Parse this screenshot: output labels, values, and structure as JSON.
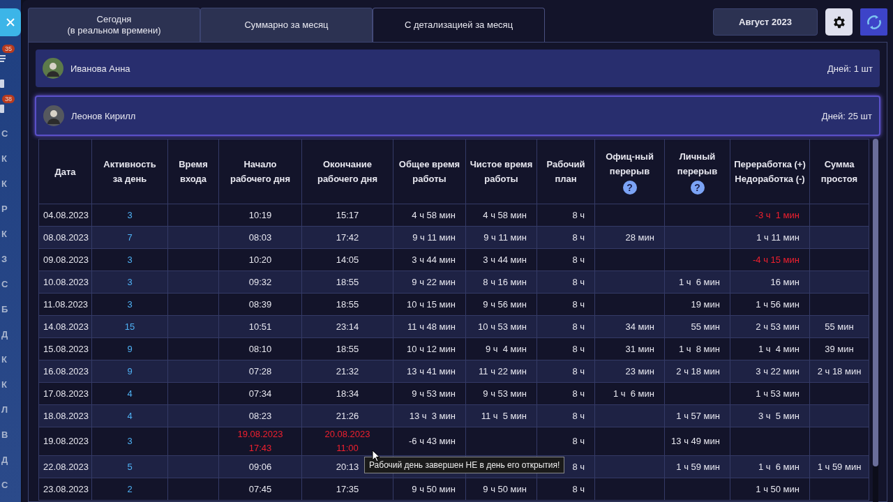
{
  "sidebar": {
    "icons": [
      {
        "kind": "list",
        "badge": "35"
      },
      {
        "kind": "square"
      },
      {
        "kind": "square",
        "badge": "38"
      }
    ],
    "letters": [
      "С",
      "К",
      "К",
      "Р",
      "К",
      "З",
      "С",
      "Б",
      "Д",
      "К",
      "К",
      "Л",
      "В",
      "Д",
      "С"
    ]
  },
  "tabs": [
    {
      "label": "Сегодня\n(в реальном времени)",
      "selected": false
    },
    {
      "label": "Суммарно за месяц",
      "selected": false
    },
    {
      "label": "С детализацией за месяц",
      "selected": true
    }
  ],
  "month_button": "Август 2023",
  "employees": [
    {
      "name": "Иванова Анна",
      "days": "Дней: 1 шт",
      "expanded": false
    },
    {
      "name": "Леонов Кирилл",
      "days": "Дней: 25 шт",
      "expanded": true
    }
  ],
  "table": {
    "columns": [
      {
        "label": "Дата"
      },
      {
        "label": "Активность\nза день"
      },
      {
        "label": "Время\nвхода"
      },
      {
        "label": "Начало\nрабочего дня"
      },
      {
        "label": "Окончание\nрабочего дня"
      },
      {
        "label": "Общее время\nработы"
      },
      {
        "label": "Чистое время\nработы"
      },
      {
        "label": "Рабочий\nплан"
      },
      {
        "label": "Офиц-ный\nперерыв",
        "help_icon": "?"
      },
      {
        "label": "Личный\nперерыв",
        "help_icon": "?"
      },
      {
        "label": "Переработка (+)\nНедоработка (-)"
      },
      {
        "label": "Сумма\nпростоя"
      }
    ],
    "rows": [
      {
        "cells": [
          "04.08.2023",
          "3",
          null,
          "10:19",
          "15:17",
          "4 ч 58 мин",
          "4 ч 58 мин",
          "8 ч",
          null,
          null,
          "-3 ч  1 мин",
          null
        ],
        "crossed_midnight": false,
        "overtime_negative": true
      },
      {
        "cells": [
          "08.08.2023",
          "7",
          null,
          "08:03",
          "17:42",
          "9 ч 11 мин",
          "9 ч 11 мин",
          "8 ч",
          "28 мин",
          null,
          "1 ч 11 мин",
          null
        ],
        "crossed_midnight": false,
        "overtime_negative": false
      },
      {
        "cells": [
          "09.08.2023",
          "3",
          null,
          "10:20",
          "14:05",
          "3 ч 44 мин",
          "3 ч 44 мин",
          "8 ч",
          null,
          null,
          "-4 ч 15 мин",
          null
        ],
        "crossed_midnight": false,
        "overtime_negative": true
      },
      {
        "cells": [
          "10.08.2023",
          "3",
          null,
          "09:32",
          "18:55",
          "9 ч 22 мин",
          "8 ч 16 мин",
          "8 ч",
          null,
          "1 ч  6 мин",
          "16 мин",
          null
        ],
        "crossed_midnight": false,
        "overtime_negative": false
      },
      {
        "cells": [
          "11.08.2023",
          "3",
          null,
          "08:39",
          "18:55",
          "10 ч 15 мин",
          "9 ч 56 мин",
          "8 ч",
          null,
          "19 мин",
          "1 ч 56 мин",
          null
        ],
        "crossed_midnight": false,
        "overtime_negative": false
      },
      {
        "cells": [
          "14.08.2023",
          "15",
          null,
          "10:51",
          "23:14",
          "11 ч 48 мин",
          "10 ч 53 мин",
          "8 ч",
          "34 мин",
          "55 мин",
          "2 ч 53 мин",
          "55 мин"
        ],
        "crossed_midnight": false,
        "overtime_negative": false
      },
      {
        "cells": [
          "15.08.2023",
          "9",
          null,
          "08:10",
          "18:55",
          "10 ч 12 мин",
          "9 ч  4 мин",
          "8 ч",
          "31 мин",
          "1 ч  8 мин",
          "1 ч  4 мин",
          "39 мин"
        ],
        "crossed_midnight": false,
        "overtime_negative": false
      },
      {
        "cells": [
          "16.08.2023",
          "9",
          null,
          "07:28",
          "21:32",
          "13 ч 41 мин",
          "11 ч 22 мин",
          "8 ч",
          "23 мин",
          "2 ч 18 мин",
          "3 ч 22 мин",
          "2 ч 18 мин"
        ],
        "crossed_midnight": false,
        "overtime_negative": false
      },
      {
        "cells": [
          "17.08.2023",
          "4",
          null,
          "07:34",
          "18:34",
          "9 ч 53 мин",
          "9 ч 53 мин",
          "8 ч",
          "1 ч  6 мин",
          null,
          "1 ч 53 мин",
          null
        ],
        "crossed_midnight": false,
        "overtime_negative": false
      },
      {
        "cells": [
          "18.08.2023",
          "4",
          null,
          "08:23",
          "21:26",
          "13 ч  3 мин",
          "11 ч  5 мин",
          "8 ч",
          null,
          "1 ч 57 мин",
          "3 ч  5 мин",
          null
        ],
        "crossed_midnight": false,
        "overtime_negative": false
      },
      {
        "cells": [
          "19.08.2023",
          "3",
          null,
          "19.08.2023\n17:43",
          "20.08.2023\n11:00",
          "-6 ч 43 мин",
          null,
          "8 ч",
          null,
          "13 ч 49 мин",
          null,
          null
        ],
        "crossed_midnight": true
      },
      {
        "cells": [
          "22.08.2023",
          "5",
          null,
          "09:06",
          "20:13",
          null,
          null,
          "8 ч",
          null,
          "1 ч 59 мин",
          "1 ч  6 мин",
          "1 ч 59 мин"
        ],
        "crossed_midnight": false,
        "overtime_negative": false
      },
      {
        "cells": [
          "23.08.2023",
          "2",
          null,
          "07:45",
          "17:35",
          "9 ч 50 мин",
          "9 ч 50 мин",
          "8 ч",
          null,
          null,
          "1 ч 50 мин",
          null
        ],
        "crossed_midnight": false,
        "overtime_negative": false
      }
    ]
  },
  "tooltip": "Рабочий день завершен НЕ в день его открытия!"
}
